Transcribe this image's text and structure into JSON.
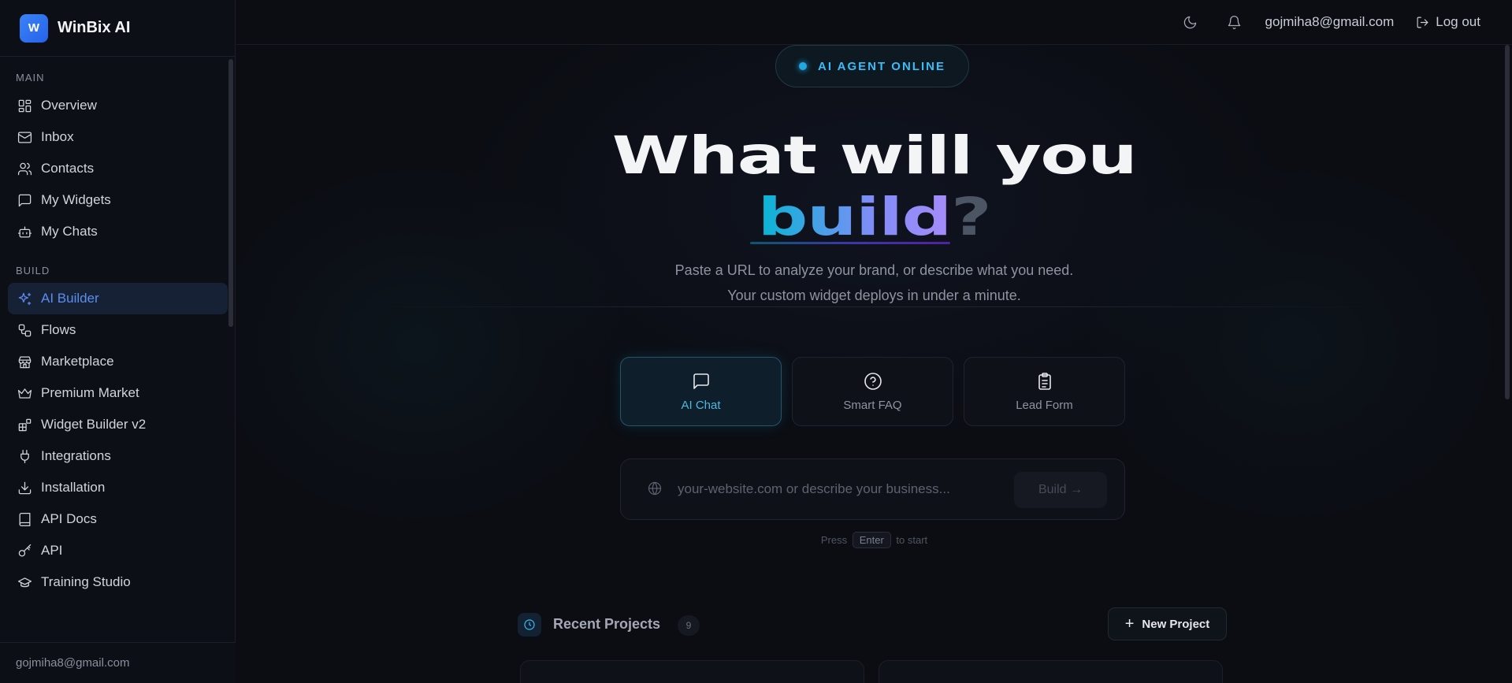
{
  "brand": {
    "logo_letter": "W",
    "name": "WinBix AI"
  },
  "sidebar": {
    "sections": [
      {
        "label": "MAIN",
        "items": [
          {
            "label": "Overview",
            "icon": "grid-icon"
          },
          {
            "label": "Inbox",
            "icon": "mail-icon"
          },
          {
            "label": "Contacts",
            "icon": "users-icon"
          },
          {
            "label": "My Widgets",
            "icon": "message-square-icon"
          },
          {
            "label": "My Chats",
            "icon": "bot-icon"
          }
        ]
      },
      {
        "label": "BUILD",
        "items": [
          {
            "label": "AI Builder",
            "icon": "sparkles-icon",
            "active": true
          },
          {
            "label": "Flows",
            "icon": "workflow-icon"
          },
          {
            "label": "Marketplace",
            "icon": "store-icon"
          },
          {
            "label": "Premium Market",
            "icon": "crown-icon"
          },
          {
            "label": "Widget Builder v2",
            "icon": "blocks-icon"
          },
          {
            "label": "Integrations",
            "icon": "plug-icon"
          },
          {
            "label": "Installation",
            "icon": "download-icon"
          },
          {
            "label": "API Docs",
            "icon": "book-icon"
          },
          {
            "label": "API",
            "icon": "key-icon"
          },
          {
            "label": "Training Studio",
            "icon": "graduation-cap-icon"
          }
        ]
      }
    ],
    "footer_email": "gojmiha8@gmail.com"
  },
  "topbar": {
    "email": "gojmiha8@gmail.com",
    "logout_label": "Log out"
  },
  "hero": {
    "status": "AI AGENT ONLINE",
    "title_line1": "What will you",
    "title_word": "build",
    "title_mark": "?",
    "subtitle_line1": "Paste a URL to analyze your brand, or describe what you need.",
    "subtitle_line2": "Your custom widget deploys in under a minute."
  },
  "modes": [
    {
      "label": "AI Chat",
      "icon": "chat-icon",
      "active": true
    },
    {
      "label": "Smart FAQ",
      "icon": "help-circle-icon",
      "active": false
    },
    {
      "label": "Lead Form",
      "icon": "clipboard-icon",
      "active": false
    }
  ],
  "search": {
    "placeholder": "your-website.com or describe your business...",
    "value": "",
    "build_label": "Build →"
  },
  "hint": {
    "prefix": "Press",
    "key": "Enter",
    "suffix": "to start"
  },
  "recent": {
    "title": "Recent Projects",
    "count": "9",
    "new_project_label": "New Project"
  },
  "colors": {
    "accent": "#5b8def",
    "status": "#38bdf8",
    "background": "#0b0d13"
  }
}
